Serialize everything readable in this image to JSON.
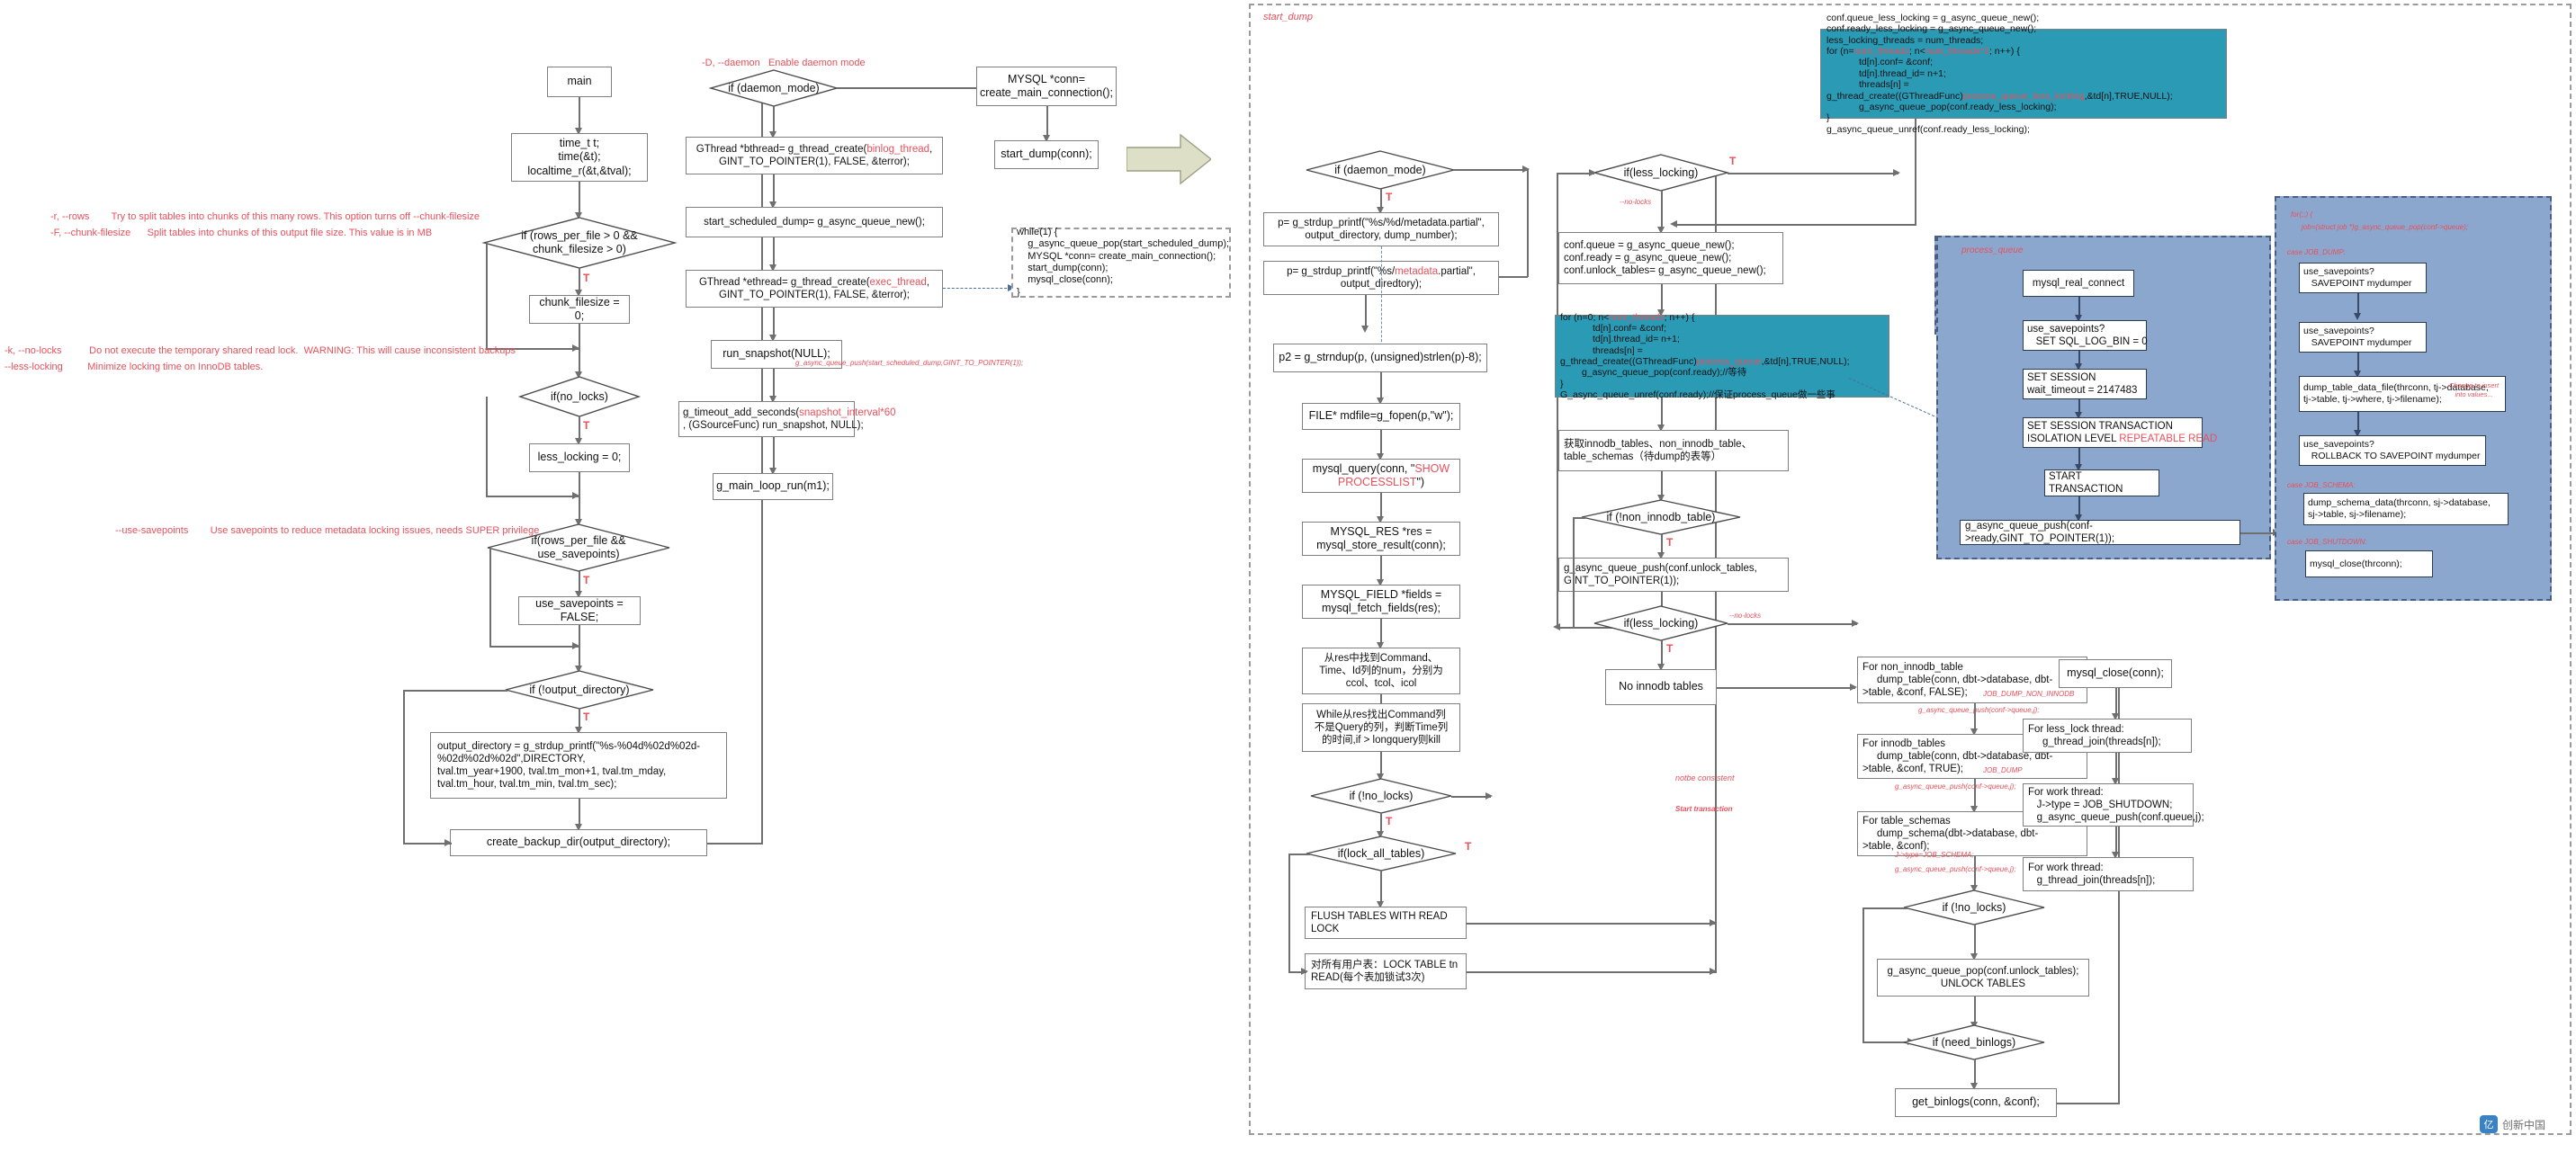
{
  "annotations": {
    "opt_rows": "-r, --rows        Try to split tables into chunks of this many rows. This option turns off --chunk-filesize",
    "opt_chunk": "-F, --chunk-filesize      Split tables into chunks of this output file size. This value is in MB",
    "opt_nolocks": "-k, --no-locks          Do not execute the temporary shared read lock.  WARNING: This will cause inconsistent backups",
    "opt_lesslocking": "--less-locking         Minimize locking time on InnoDB tables.",
    "opt_savepoints": "--use-savepoints        Use savepoints to reduce metadata locking issues, needs SUPER privilege",
    "opt_daemon": "-D, --daemon   Enable daemon mode",
    "queue_push_note": "g_async_queue_push(start_scheduled_dump,GINT_TO_POINTER(1));",
    "start_dump_title": "start_dump",
    "process_queue_title": "process_queue",
    "no_locks_tag1": "--no-locks",
    "no_locks_tag2": "--no-locks",
    "no_locks_tag3": "--no-locks",
    "notbe_consistent": "notbe consistent",
    "start_transaction": "Start transaction",
    "job_dump_non_innodb": "JOB_DUMP_NON_INNODB",
    "job_dump": "JOB_DUMP",
    "job_schema": "J->type=JOB_SCHEMA;",
    "push_conf_queue_1": "g_async_queue_push(conf->queue,j);",
    "push_conf_queue_2": "g_async_queue_push(conf->queue,j);",
    "push_conf_queue_3": "g_async_queue_push(conf->queue,j);",
    "for_loop_head": "for(;;) {",
    "job_pop": "job=(struct job *)g_async_queue_pop(conf->queue);",
    "case_job_dump": "case JOB_DUMP:",
    "case_job_schema": "case JOB_SCHEMA:",
    "case_job_shutdown": "case JOB_SHUTDOWN:",
    "change_to_insert": "Change to insert\ninto values...",
    "T": "T"
  },
  "left_column": {
    "main": "main",
    "time_block": "time_t t;\ntime(&t);\nlocaltime_r(&t,&tval);",
    "if_rows_per_file": "if (rows_per_file > 0 &&\nchunk_filesize > 0)",
    "chunk_filesize_zero": "chunk_filesize = 0;",
    "if_no_locks": "if(no_locks)",
    "less_locking_zero": "less_locking = 0;",
    "if_rows_savepoints": "if(rows_per_file &&\nuse_savepoints)",
    "use_savepoints_false": "use_savepoints = FALSE;",
    "if_output_directory": "if (!output_directory)",
    "output_directory_assign": "output_directory = g_strdup_printf(\"%s-%04d%02d%02d-\n%02d%02d%02d\",DIRECTORY,\ntval.tm_year+1900, tval.tm_mon+1, tval.tm_mday,\ntval.tm_hour, tval.tm_min, tval.tm_sec);",
    "create_backup_dir": "create_backup_dir(output_directory);"
  },
  "daemon_column": {
    "if_daemon_mode": "if (daemon_mode)",
    "bthread": "GThread *bthread= g_thread_create(",
    "bthread_red": "binlog_thread",
    "bthread_tail": ",\nGINT_TO_POINTER(1), FALSE, &terror);",
    "start_scheduled_dump": "start_scheduled_dump= g_async_queue_new();",
    "ethread": "GThread *ethread= g_thread_create(",
    "ethread_red": "exec_thread",
    "ethread_tail": ",\nGINT_TO_POINTER(1), FALSE, &terror);",
    "run_snapshot": "run_snapshot(NULL);",
    "g_timeout_pre": "g_timeout_add_seconds(",
    "g_timeout_red": "snapshot_interval*60",
    "g_timeout_post": "\n, (GSourceFunc) run_snapshot, NULL);",
    "g_main_loop_run": "g_main_loop_run(m1);",
    "mysql_conn": "MYSQL *conn=\ncreate_main_connection();",
    "start_dump_conn": "start_dump(conn);",
    "while_block": "while(1) {\n    g_async_queue_pop(start_scheduled_dump);\n    MYSQL *conn= create_main_connection();\n    start_dump(conn);\n    mysql_close(conn);\n}"
  },
  "start_dump": {
    "if_daemon_mode": "if (daemon_mode)",
    "p_partial_daemon": "p= g_strdup_printf(\"%s/%d/metadata.partial\",\noutput_directory, dump_number);",
    "p_partial_pre": "p= g_strdup_printf(\"%s/",
    "p_partial_red": "metadata",
    "p_partial_post": ".partial\",\noutput_diredtory);",
    "p2_strndup": "p2 = g_strndup(p, (unsigned)strlen(p)-8);",
    "mdfile": "FILE* mdfile=g_fopen(p,\"w\");",
    "mysql_query_pre": "mysql_query(conn, \"",
    "mysql_query_red": "SHOW\nPROCESSLIST",
    "mysql_query_post": "\")",
    "mysql_res": "MYSQL_RES *res =\nmysql_store_result(conn);",
    "mysql_field": "MYSQL_FIELD *fields =\nmysql_fetch_fields(res);",
    "find_cols": "从res中找到Command、\nTime、Id列的num，分别为\nccol、tcol、icol",
    "while_kill": "While从res找出Command列\n不是Query的列，判断Time列\n的时间,if > longquery则kill",
    "if_not_no_locks": "if (!no_locks)",
    "if_lock_all_tables": "if(lock_all_tables)",
    "flush_tables": "FLUSH TABLES WITH READ LOCK",
    "lock_table_read": "对所有用户表：LOCK TABLE tn\nREAD(每个表加锁试3次)"
  },
  "less_locking": {
    "if_less_locking": "if(less_locking)",
    "conf_queues": "conf.queue = g_async_queue_new();\nconf.ready = g_async_queue_new();\nconf.unlock_tables= g_async_queue_new();",
    "teal_top": {
      "l1": "conf.queue_less_locking = g_async_queue_new();",
      "l2": "conf.ready_less_locking = g_async_queue_new();",
      "l3": "less_locking_threads = num_threads;",
      "l4_pre": "for (n=",
      "l4_red1": "num_threads",
      "l4_mid": "; n<",
      "l4_red2": "num_threads*2",
      "l4_post": "; n++) {",
      "l5": "td[n].conf= &conf;",
      "l6": "td[n].thread_id= n+1;",
      "l7": "threads[n] =",
      "l8_pre": "g_thread_create((GThreadFunc)",
      "l8_red": "process_queue_less_locking",
      "l8_post": ",&td[n],TRUE,NULL);",
      "l9": "g_async_queue_pop(conf.ready_less_locking);",
      "l10": "}",
      "l11": "g_async_queue_unref(conf.ready_less_locking);"
    },
    "teal_mid": {
      "l1_pre": "for (n=0; n<",
      "l1_red": "num_threads",
      "l1_post": "; n++) {",
      "l2": "td[n].conf= &conf;",
      "l3": "td[n].thread_id= n+1;",
      "l4": "threads[n] =",
      "l5_pre": "g_thread_create((GThreadFunc)",
      "l5_red": "process_queue",
      "l5_post": ",&td[n],TRUE,NULL);",
      "l6": "g_async_queue_pop(conf.ready);//等待",
      "l7": "}",
      "l8": "G_async_queue_unref(conf.ready);//保证process_queue做一些事"
    },
    "get_tables": "获取innodb_tables、non_innodb_table、\ntable_schemas（待dump的表等）",
    "if_not_non_innodb": "if (!non_innodb_table)",
    "push_unlock_tables": "g_async_queue_push(conf.unlock_tables,\nGINT_TO_POINTER(1));",
    "if_less_locking2": "if(less_locking)",
    "no_innodb_tables": "No innodb tables"
  },
  "dump_column": {
    "for_non_innodb": "For non_innodb_table\n     dump_table(conn, dbt->database, dbt-\n>table, &conf, FALSE);",
    "for_innodb": "For innodb_tables\n     dump_table(conn, dbt->database, dbt-\n>table, &conf, TRUE);",
    "for_table_schemas": "For table_schemas\n     dump_schema(dbt->database, dbt-\n>table, &conf);",
    "if_not_no_locks2": "if (!no_locks)",
    "unlock_tables": "g_async_queue_pop(conf.unlock_tables);\nUNLOCK TABLES",
    "if_need_binlogs": "if (need_binlogs)",
    "get_binlogs": "get_binlogs(conn, &conf);"
  },
  "finish_column": {
    "mysql_close_conn": "mysql_close(conn);",
    "for_less_lock_thread": "For less_lock thread:\n     g_thread_join(threads[n]);",
    "for_work_thread_shutdown": "For work thread:\n   J->type = JOB_SHUTDOWN;\n   g_async_queue_push(conf.queue,j);",
    "for_work_thread_join": "For work thread:\n   g_thread_join(threads[n]);"
  },
  "process_queue_box": {
    "mysql_real_connect": "mysql_real_connect",
    "use_savepoints_logbin": "use_savepoints?\n   SET SQL_LOG_BIN = 0",
    "set_session_wait": "SET SESSION\nwait_timeout = 2147483",
    "set_session_iso_pre": "SET SESSION TRANSACTION\nISOLATION LEVEL ",
    "set_session_iso_red": "REPEATABLE READ",
    "start_transaction": "START TRANSACTION",
    "queue_push_ready": "g_async_queue_push(conf->ready,GINT_TO_POINTER(1));"
  },
  "job_box": {
    "savepoint1": "use_savepoints?\n   SAVEPOINT mydumper",
    "savepoint2": "use_savepoints?\n   SAVEPOINT mydumper",
    "dump_table_data_file": "dump_table_data_file(thrconn, tj->database,\ntj->table, tj->where, tj->filename);",
    "rollback_savepoint": "use_savepoints?\n   ROLLBACK TO SAVEPOINT mydumper",
    "dump_schema_data": "dump_schema_data(thrconn, sj->database,\nsj->table, sj->filename);",
    "mysql_close_thrconn": "mysql_close(thrconn);"
  },
  "watermark": {
    "text": "创新中国",
    "logo": "亿"
  },
  "colors": {
    "teal": "#2a9ab5",
    "purple": "#8ca7cd",
    "red": "#e8505b",
    "stroke": "#7f7f7f"
  }
}
